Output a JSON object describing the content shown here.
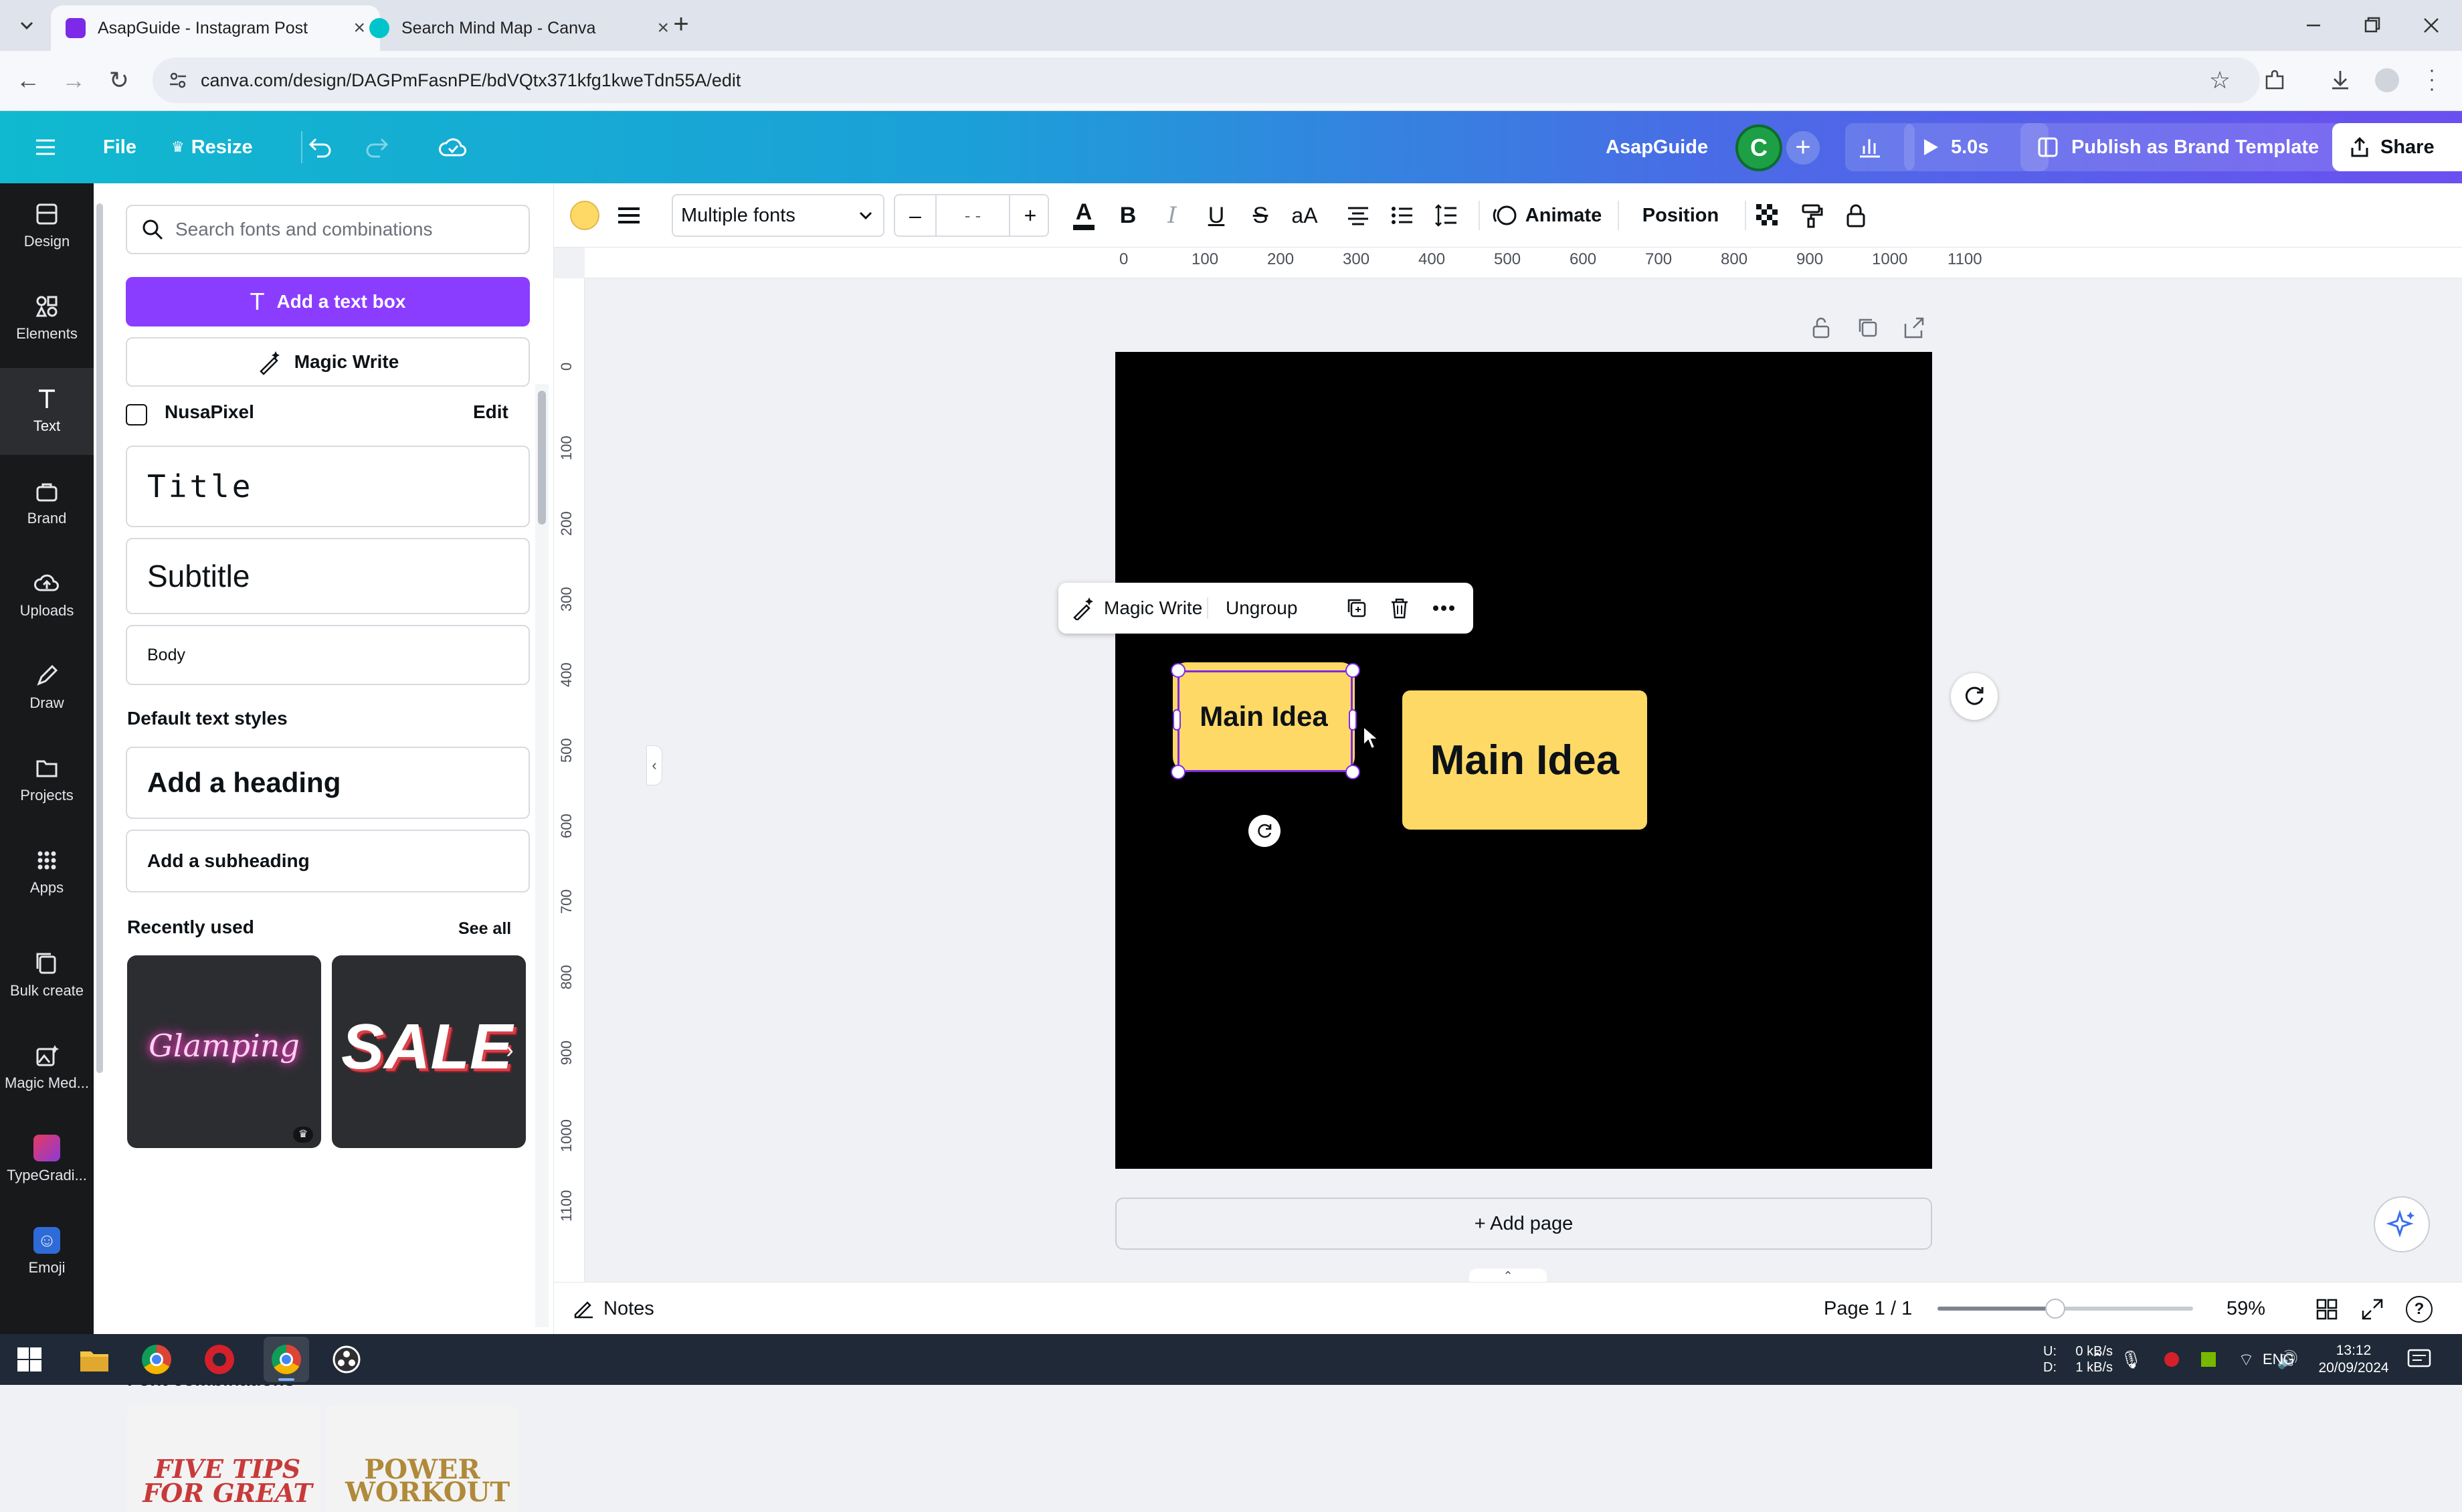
{
  "browser": {
    "tabs": [
      {
        "title": "AsapGuide - Instagram Post",
        "active": true,
        "favicon_color": "#7d2ae8"
      },
      {
        "title": "Search Mind Map - Canva",
        "active": false,
        "favicon_color": "#00c4cc"
      }
    ],
    "new_tab_label": "+",
    "url": "canva.com/design/DAGPmFasnPE/bdVQtx371kfg1kweTdn55A/edit"
  },
  "topbar": {
    "file_label": "File",
    "resize_label": "Resize",
    "brand_name": "AsapGuide",
    "avatar_letter": "C",
    "timer_label": "5.0s",
    "publish_label": "Publish as Brand Template",
    "share_label": "Share",
    "gradient_colors": [
      "#10b9cf",
      "#6b4ff0"
    ]
  },
  "rail": {
    "items": [
      {
        "label": "Design",
        "icon": "design-icon"
      },
      {
        "label": "Elements",
        "icon": "elements-icon"
      },
      {
        "label": "Text",
        "icon": "text-icon"
      },
      {
        "label": "Brand",
        "icon": "brand-icon"
      },
      {
        "label": "Uploads",
        "icon": "uploads-icon"
      },
      {
        "label": "Draw",
        "icon": "draw-icon"
      },
      {
        "label": "Projects",
        "icon": "projects-icon"
      },
      {
        "label": "Apps",
        "icon": "apps-icon"
      },
      {
        "label": "Bulk create",
        "icon": "bulk-create-icon"
      },
      {
        "label": "Magic Med...",
        "icon": "magic-media-icon"
      },
      {
        "label": "TypeGradi...",
        "icon": "typegradient-icon"
      },
      {
        "label": "Emoji",
        "icon": "emoji-icon"
      }
    ],
    "active_item": "Text"
  },
  "panel": {
    "search_placeholder": "Search fonts and combinations",
    "add_text_box": "Add a text box",
    "magic_write": "Magic Write",
    "brand_kit_name": "NusaPixel",
    "brand_kit_edit": "Edit",
    "brand_title": "Title",
    "brand_subtitle": "Subtitle",
    "brand_body": "Body",
    "default_styles_heading": "Default text styles",
    "add_heading": "Add a heading",
    "add_subheading": "Add a subheading",
    "recently_used_heading": "Recently used",
    "see_all": "See all",
    "recent_thumbs": [
      "Glamping",
      "SALE"
    ],
    "font_combinations_heading": "Font combinations",
    "combo_thumbs": [
      "FIVE TIPS FOR GREAT",
      "POWER WORKOUT"
    ],
    "accent_color": "#7d2ae8"
  },
  "context_toolbar": {
    "fill_color": "#ffd966",
    "font_name": "Multiple fonts",
    "minus": "–",
    "size_value": "- -",
    "plus": "+",
    "animate_label": "Animate",
    "position_label": "Position"
  },
  "rulers": {
    "horizontal": [
      "0",
      "100",
      "200",
      "300",
      "400",
      "500",
      "600",
      "700",
      "800",
      "900",
      "1000",
      "1100"
    ],
    "vertical": [
      "0",
      "100",
      "200",
      "300",
      "400",
      "500",
      "600",
      "700",
      "800",
      "900",
      "1000",
      "1100"
    ]
  },
  "canvas": {
    "background": "#000000",
    "floating_toolbar": {
      "magic_write": "Magic Write",
      "ungroup": "Ungroup"
    },
    "box_small_text": "Main Idea",
    "box_large_text": "Main Idea",
    "box_color": "#ffd966",
    "add_page": "+ Add page"
  },
  "footer": {
    "notes_label": "Notes",
    "page_indicator": "Page 1 / 1",
    "zoom_level": "59%",
    "zoom_fraction": 0.46
  },
  "taskbar": {
    "net_up": "0 kB/s",
    "net_down": "1 kB/s",
    "net_up_label": "U:",
    "net_down_label": "D:",
    "language": "ENG",
    "time": "13:12",
    "date": "20/09/2024"
  }
}
